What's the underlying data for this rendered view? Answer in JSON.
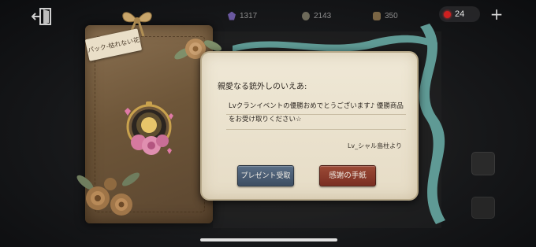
{
  "resources": {
    "gem": {
      "value": "1317",
      "icon": "purple-gem-icon",
      "color": "#6a58a0"
    },
    "clue": {
      "value": "2143",
      "icon": "clue-icon"
    },
    "coin": {
      "value": "350",
      "icon": "coin-icon"
    },
    "red": {
      "value": "24",
      "icon": "red-orb-icon",
      "color": "#d02020"
    }
  },
  "envelope": {
    "tag_label": "パック-枯れない花"
  },
  "letter": {
    "greeting": "親愛なる銃外しのいえあ:",
    "message": "Lvクランイベントの優勝おめでとうございます♪ 優勝商品をお受け取りください☆",
    "signature": "Lv_シャル島柱より"
  },
  "buttons": {
    "receive_gift": "プレゼント受取",
    "thank_you_letter": "感謝の手紙"
  },
  "colors": {
    "card_bg": "#efe8d6",
    "ribbon": "#5f9a95",
    "gift_button": "#4a5d75",
    "thanks_button": "#8a3a2c"
  }
}
